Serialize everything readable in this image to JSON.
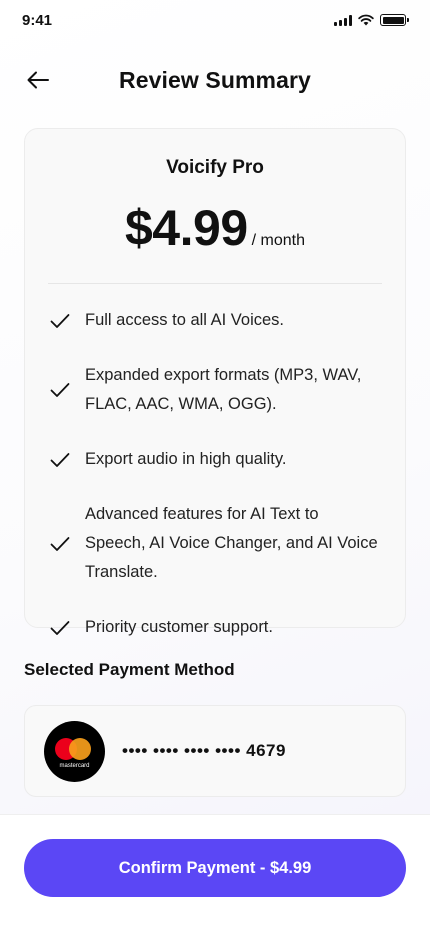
{
  "status_bar": {
    "time": "9:41"
  },
  "header": {
    "title": "Review Summary",
    "back_icon": "arrow-left-icon"
  },
  "plan": {
    "name": "Voicify Pro",
    "price": "$4.99",
    "period": "/ month",
    "features": [
      "Full access to all AI Voices.",
      "Expanded export formats (MP3, WAV, FLAC, AAC, WMA, OGG).",
      "Export audio in high quality.",
      "Advanced features for AI Text to Speech, AI Voice Changer, and AI Voice Translate.",
      "Priority customer support."
    ]
  },
  "payment": {
    "section_title": "Selected Payment Method",
    "card_brand": "mastercard",
    "card_number": "•••• •••• •••• •••• 4679"
  },
  "footer": {
    "confirm_label": "Confirm Payment - $4.99"
  },
  "colors": {
    "accent": "#5b47f5",
    "card_bg": "#f9f9f9"
  }
}
